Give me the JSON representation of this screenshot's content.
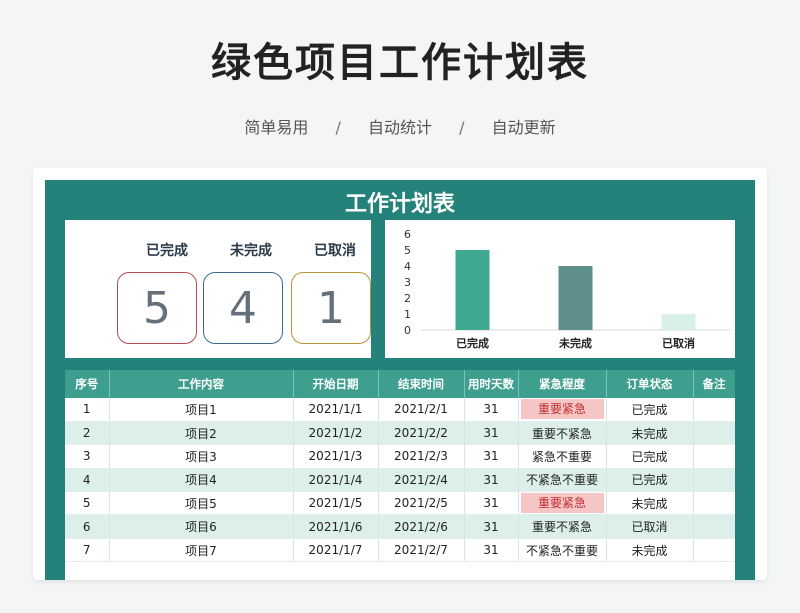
{
  "page": {
    "title": "绿色项目工作计划表",
    "subtitle_items": [
      "简单易用",
      "自动统计",
      "自动更新"
    ],
    "subtitle_sep": "/"
  },
  "sheet": {
    "title": "工作计划表",
    "stats": [
      {
        "label": "已完成",
        "value": "5",
        "color": "#b94a56"
      },
      {
        "label": "未完成",
        "value": "4",
        "color": "#3d6a8c"
      },
      {
        "label": "已取消",
        "value": "1",
        "color": "#b8952e"
      }
    ]
  },
  "chart_data": {
    "type": "bar",
    "categories": [
      "已完成",
      "未完成",
      "已取消"
    ],
    "values": [
      5,
      4,
      1
    ],
    "colors": [
      "#3ea890",
      "#5f8f8a",
      "#d9f0ea"
    ],
    "ylim": [
      0,
      6
    ],
    "yticks": [
      "0",
      "1",
      "2",
      "3",
      "4",
      "5",
      "6"
    ],
    "grid": false
  },
  "table": {
    "headers": [
      "序号",
      "工作内容",
      "开始日期",
      "结束时间",
      "用时天数",
      "紧急程度",
      "订单状态",
      "备注"
    ],
    "rows": [
      [
        "1",
        "项目1",
        "2021/1/1",
        "2021/2/1",
        "31",
        "重要紧急",
        "已完成",
        ""
      ],
      [
        "2",
        "项目2",
        "2021/1/2",
        "2021/2/2",
        "31",
        "重要不紧急",
        "未完成",
        ""
      ],
      [
        "3",
        "项目3",
        "2021/1/3",
        "2021/2/3",
        "31",
        "紧急不重要",
        "已完成",
        ""
      ],
      [
        "4",
        "项目4",
        "2021/1/4",
        "2021/2/4",
        "31",
        "不紧急不重要",
        "已完成",
        ""
      ],
      [
        "5",
        "项目5",
        "2021/1/5",
        "2021/2/5",
        "31",
        "重要紧急",
        "未完成",
        ""
      ],
      [
        "6",
        "项目6",
        "2021/1/6",
        "2021/2/6",
        "31",
        "重要不紧急",
        "已取消",
        ""
      ],
      [
        "7",
        "项目7",
        "2021/1/7",
        "2021/2/7",
        "31",
        "不紧急不重要",
        "未完成",
        ""
      ]
    ],
    "highlight_value": "重要紧急",
    "highlight_color": "#f6c6c6"
  }
}
